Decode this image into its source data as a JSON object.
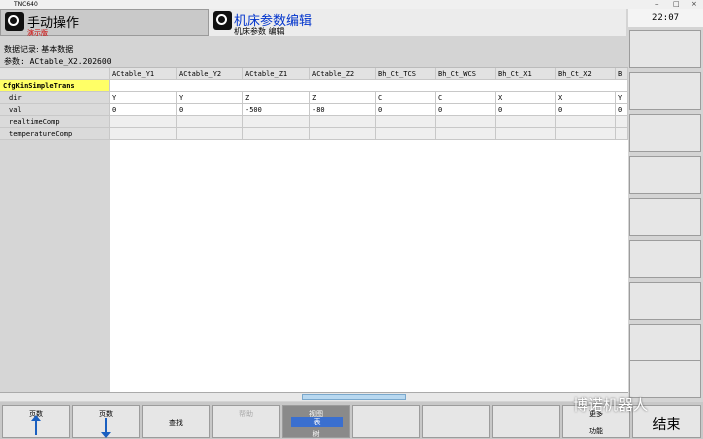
{
  "window": {
    "title": "TNC640",
    "controls": [
      "–",
      "□",
      "×"
    ]
  },
  "mode_primary": {
    "title": "手动操作",
    "subtitle": "演示版"
  },
  "mode_secondary": {
    "title": "机床参数编辑",
    "subtitle": "机床参数 编辑"
  },
  "clock": "22:07",
  "record_line": "数据记录: 基本数据",
  "param_line": "参数: ACtable_X2.202600",
  "table": {
    "group": "CfgKinSimpleTrans",
    "columns": [
      "ACtable_Y1",
      "ACtable_Y2",
      "ACtable_Z1",
      "ACtable_Z2",
      "Bh_Ct_TCS",
      "Bh_Ct_WCS",
      "Bh_Ct_X1",
      "Bh_Ct_X2",
      "B"
    ],
    "rows": [
      {
        "label": "dir",
        "values": [
          "Y",
          "Y",
          "Z",
          "Z",
          "C",
          "C",
          "X",
          "X",
          "Y"
        ]
      },
      {
        "label": "val",
        "values": [
          "0",
          "0",
          "-500",
          "-80",
          "0",
          "0",
          "0",
          "0",
          "0"
        ]
      },
      {
        "label": "realtimeComp",
        "values": [
          "",
          "",
          "",
          "",
          "",
          "",
          "",
          "",
          ""
        ]
      },
      {
        "label": "temperatureComp",
        "values": [
          "",
          "",
          "",
          "",
          "",
          "",
          "",
          "",
          ""
        ]
      }
    ]
  },
  "softkeys": {
    "page_up": "页数",
    "page_down": "页数",
    "find": "查找",
    "help": "帮助",
    "view": "视图",
    "view_toggle": "表",
    "view_sub": "树",
    "func_top": "更多",
    "func_bottom": "功能",
    "end": "结束"
  },
  "watermark": "博诺机器人"
}
